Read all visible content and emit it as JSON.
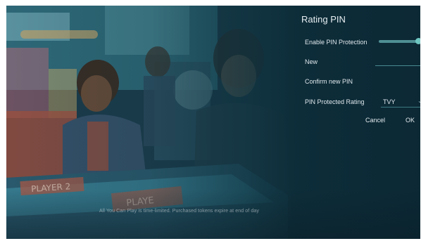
{
  "video": {
    "caption": "All You Can Play is time-limited. Purchased tokens expire at end of day"
  },
  "dialog": {
    "title": "Rating PIN",
    "enable_label": "Enable PIN Protection",
    "enable_on": true,
    "new_label": "New",
    "new_value": "",
    "confirm_label": "Confirm new PIN",
    "confirm_value": "",
    "rating_label": "PIN Protected Rating",
    "rating_value": "TVY",
    "cancel_label": "Cancel",
    "ok_label": "OK"
  },
  "colors": {
    "accent": "#6fc6c0",
    "panel_bg": "#0f3442"
  }
}
